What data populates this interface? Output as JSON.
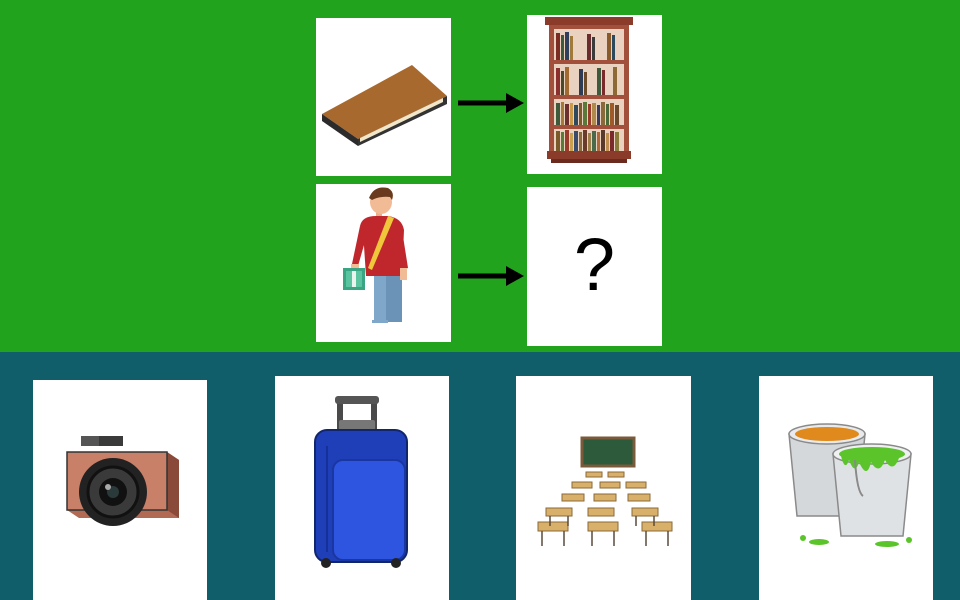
{
  "colors": {
    "top_background": "#22a31e",
    "bottom_background": "#0f5e6a",
    "card": "#ffffff",
    "arrow": "#000000"
  },
  "analogy": {
    "row1": {
      "left_icon": "book-icon",
      "right_icon": "bookshelf-icon"
    },
    "row2": {
      "left_icon": "student-icon",
      "unknown_label": "?"
    }
  },
  "choices": [
    {
      "icon": "camera-icon"
    },
    {
      "icon": "suitcase-icon"
    },
    {
      "icon": "classroom-icon"
    },
    {
      "icon": "paint-buckets-icon"
    }
  ]
}
